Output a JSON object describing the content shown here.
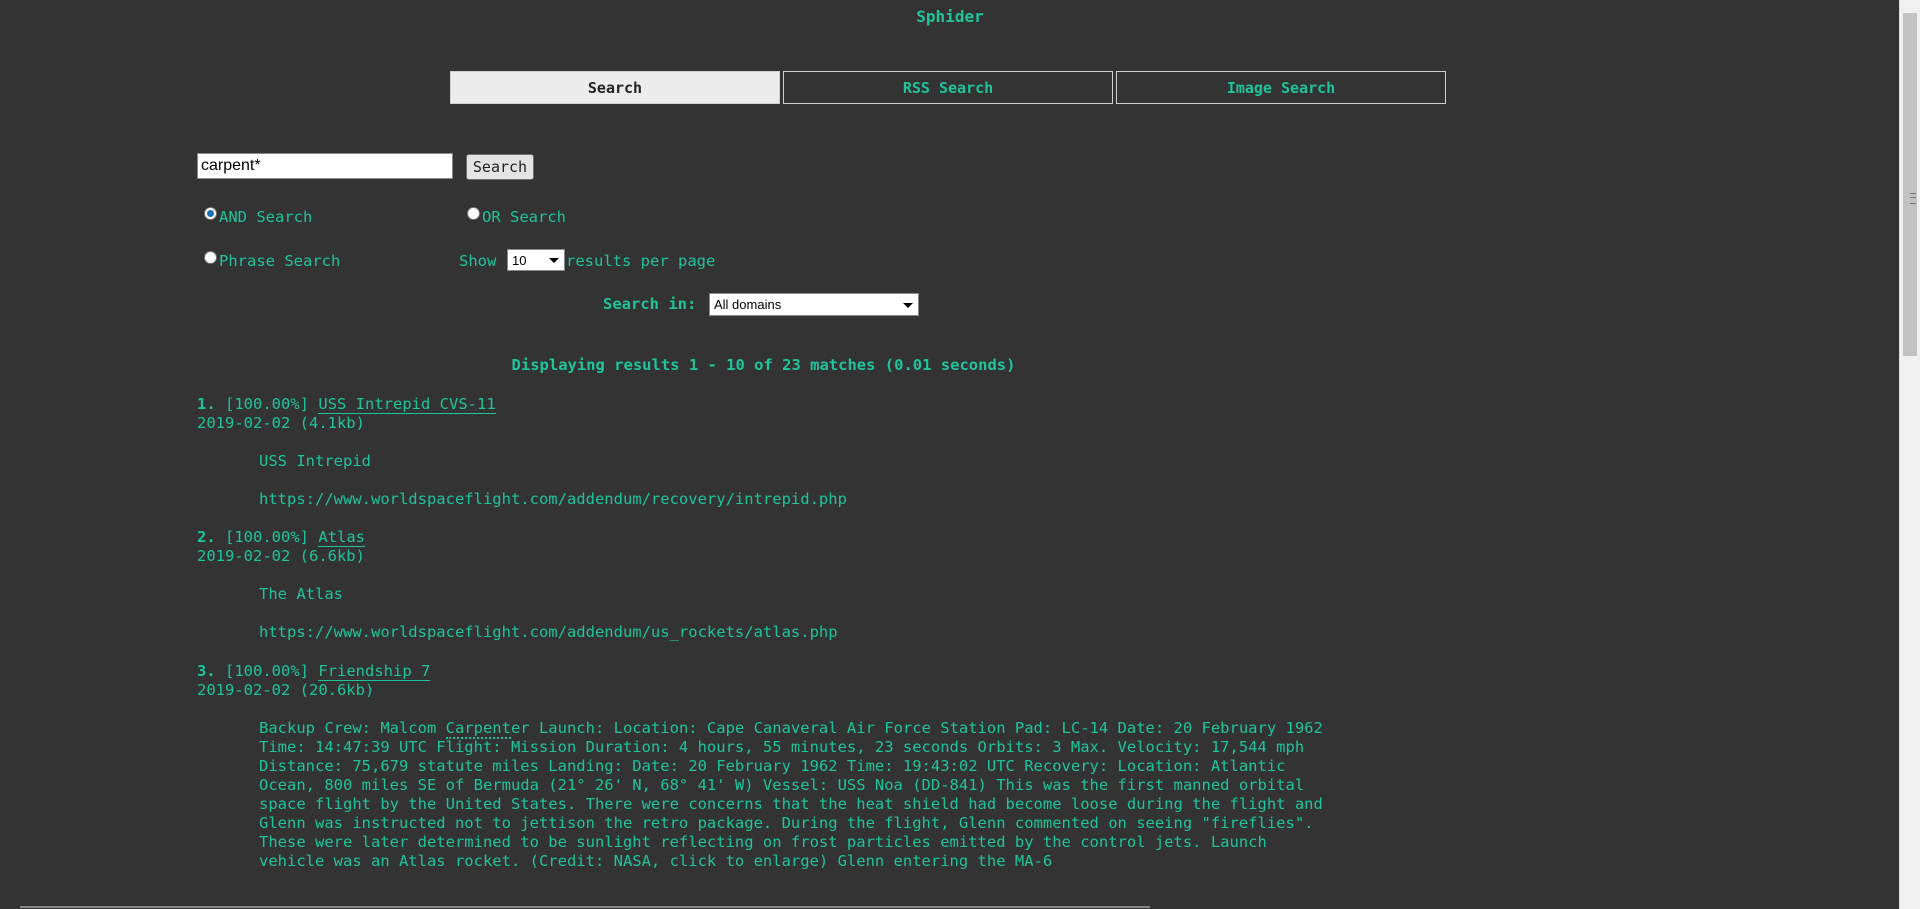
{
  "site": {
    "title": "Sphider"
  },
  "tabs": [
    {
      "label": "Search",
      "active": true
    },
    {
      "label": "RSS Search",
      "active": false
    },
    {
      "label": "Image Search",
      "active": false
    }
  ],
  "search": {
    "query": "carpent*",
    "button_label": "Search"
  },
  "options": {
    "and_label": "AND Search",
    "or_label": "OR Search",
    "phrase_label": "Phrase Search",
    "show_label": "Show",
    "per_page_value": "10",
    "per_page_suffix": "results per page",
    "search_in_label": "Search in:",
    "domain_value": "All domains"
  },
  "summary": "Displaying results 1 - 10 of 23 matches (0.01 seconds)",
  "results": [
    {
      "num": "1.",
      "score": "[100.00%]",
      "title": "USS Intrepid CVS-11",
      "meta": "2019-02-02 (4.1kb)",
      "snippet": "USS Intrepid",
      "url": "https://www.worldspaceflight.com/addendum/recovery/intrepid.php"
    },
    {
      "num": "2.",
      "score": "[100.00%]",
      "title": "Atlas",
      "meta": "2019-02-02 (6.6kb)",
      "snippet": "The Atlas",
      "url": "https://www.worldspaceflight.com/addendum/us_rockets/atlas.php"
    },
    {
      "num": "3.",
      "score": "[100.00%]",
      "title": "Friendship 7",
      "meta": "2019-02-02 (20.6kb)",
      "snippet_before": "Backup Crew: Malcom ",
      "snippet_highlight": "Carpent",
      "snippet_after": "er Launch: Location: Cape Canaveral Air Force Station Pad: LC-14 Date: 20 February 1962 Time: 14:47:39 UTC Flight: Mission Duration: 4 hours, 55 minutes, 23 seconds Orbits: 3 Max. Velocity: 17,544 mph Distance: 75,679 statute miles Landing: Date: 20 February 1962 Time: 19:43:02 UTC Recovery: Location: Atlantic Ocean, 800 miles SE of Bermuda (21° 26' N, 68° 41' W) Vessel: USS Noa (DD-841) This was the first manned orbital space flight by the United States. There were concerns that the heat shield had become loose during the flight and Glenn was instructed not to jettison the retro package. During the flight, Glenn commented on seeing \"fireflies\". These were later determined to be sunlight reflecting on frost particles emitted by the control jets. Launch vehicle was an Atlas rocket. (Credit: NASA, click to enlarge) Glenn entering the MA-6"
    }
  ]
}
